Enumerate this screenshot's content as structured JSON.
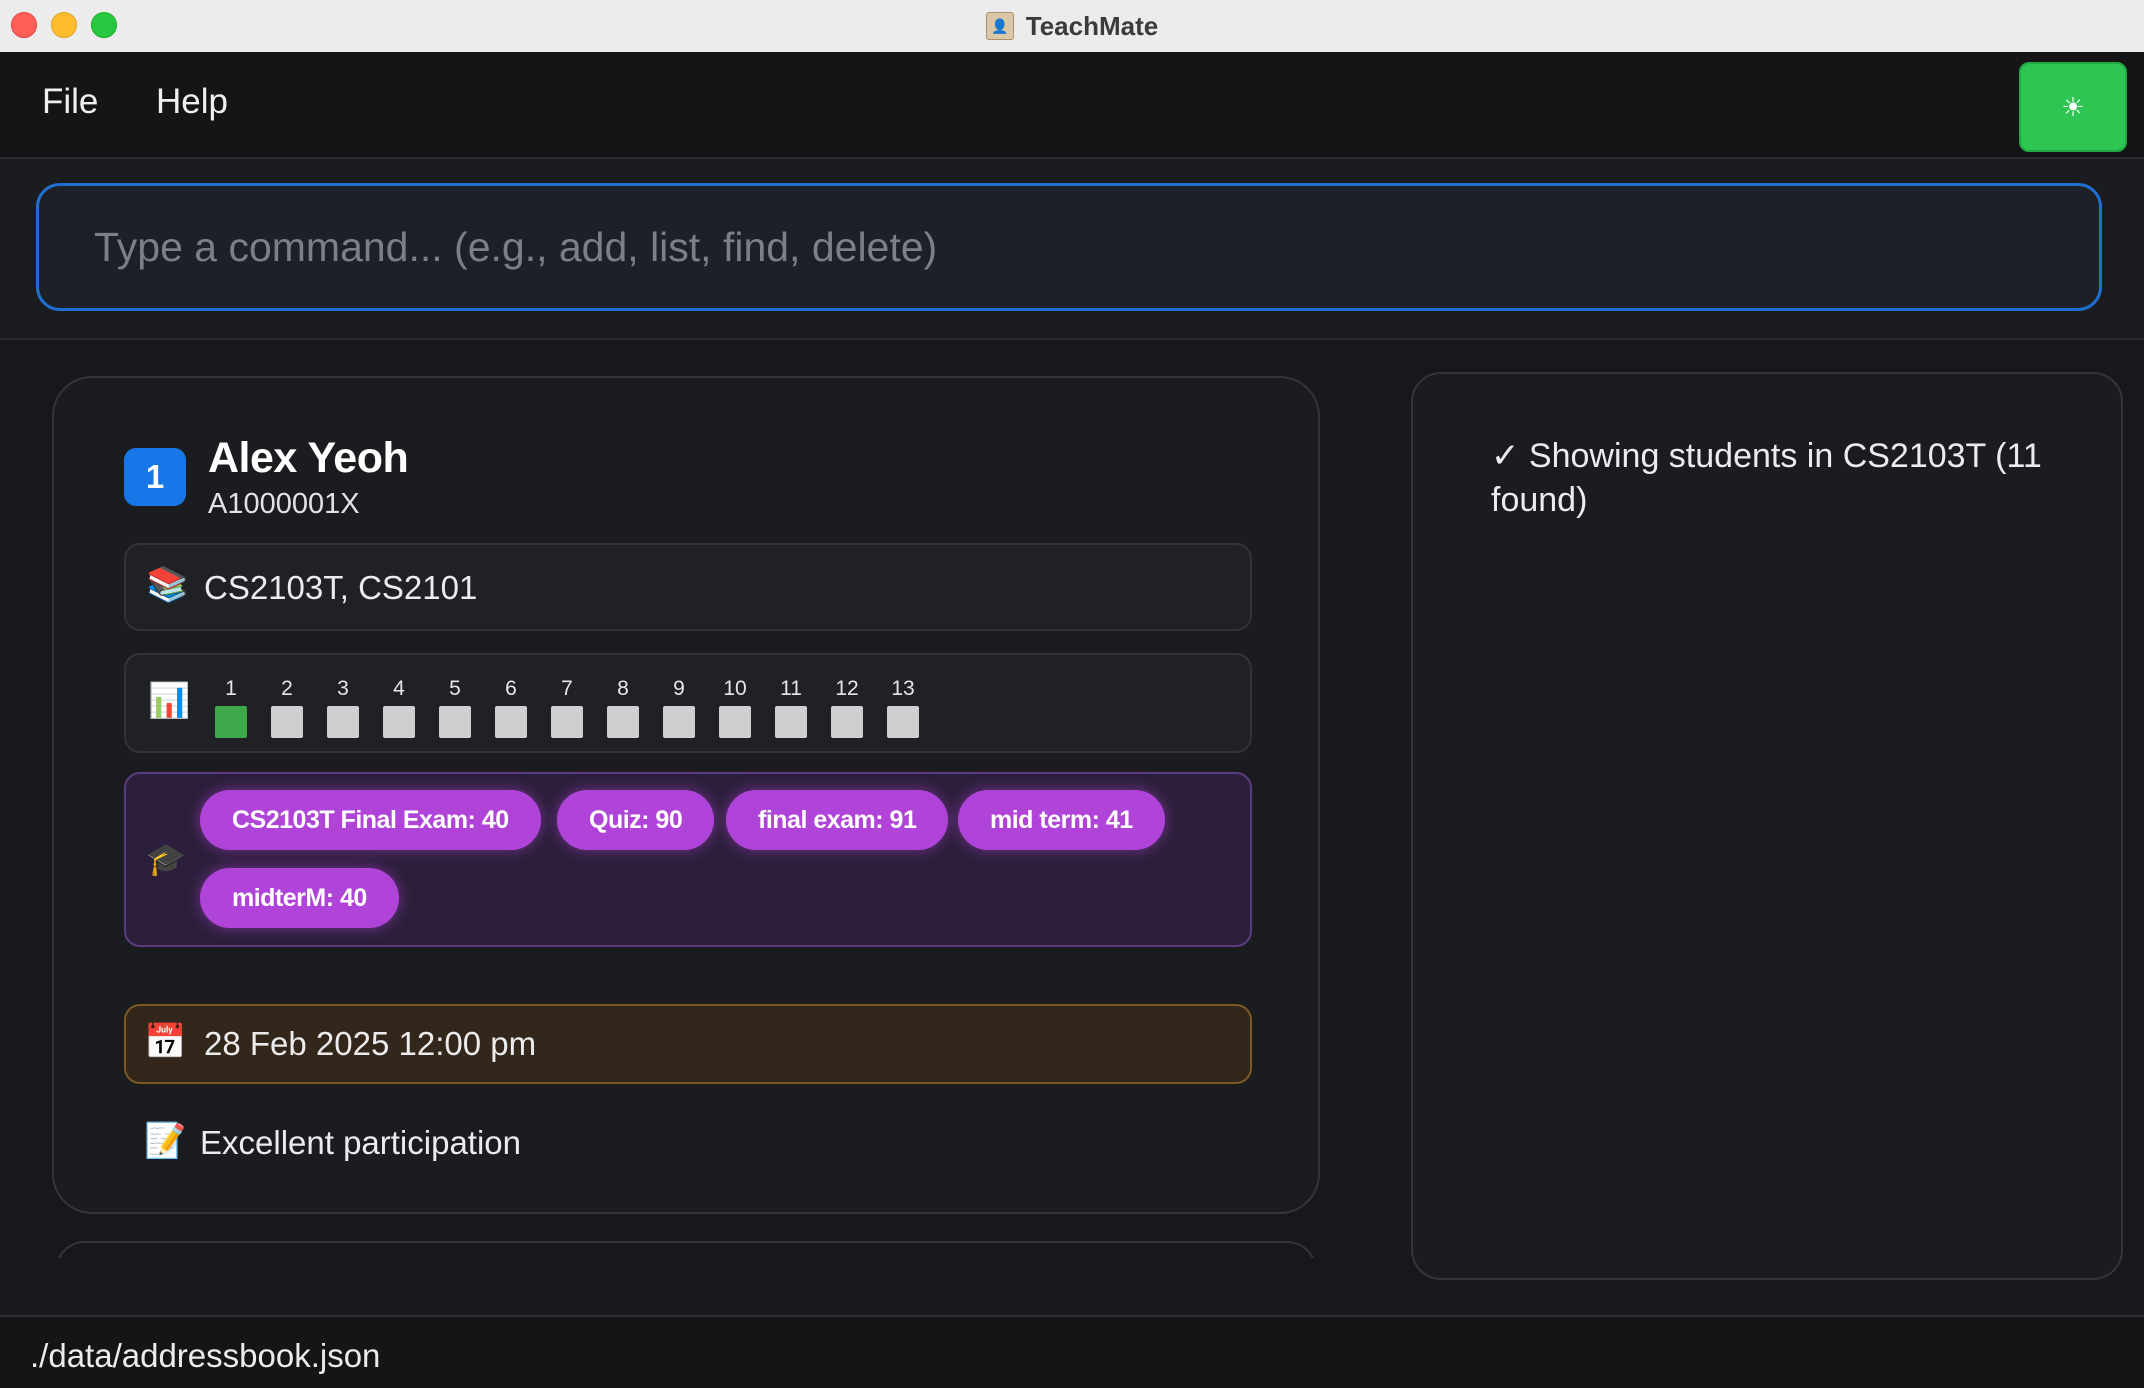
{
  "window": {
    "title": "TeachMate"
  },
  "menu": {
    "file": "File",
    "help": "Help",
    "theme_toggle_icon": "sun-icon"
  },
  "command": {
    "placeholder": "Type a command... (e.g., add, list, find, delete)",
    "value": ""
  },
  "student": {
    "index": "1",
    "name": "Alex Yeoh",
    "id": "A1000001X",
    "modules": "CS2103T, CS2101",
    "attendance": {
      "weeks": [
        "1",
        "2",
        "3",
        "4",
        "5",
        "6",
        "7",
        "8",
        "9",
        "10",
        "11",
        "12",
        "13"
      ],
      "present": [
        true,
        false,
        false,
        false,
        false,
        false,
        false,
        false,
        false,
        false,
        false,
        false,
        false
      ]
    },
    "grades": [
      "CS2103T Final Exam: 40",
      "Quiz: 90",
      "final exam: 91",
      "mid term: 41",
      "midterM: 40"
    ],
    "datetime": "28 Feb 2025 12:00 pm",
    "remark": "Excellent participation"
  },
  "result": {
    "message": "✓ Showing students in CS2103T (11 found)"
  },
  "status": {
    "file_path": "./data/addressbook.json"
  },
  "colors": {
    "accent": "#1877e8",
    "theme_button": "#2dc653",
    "grade_tag": "#b044d8",
    "present": "#3fa84a",
    "absent": "#cfcfd2"
  }
}
